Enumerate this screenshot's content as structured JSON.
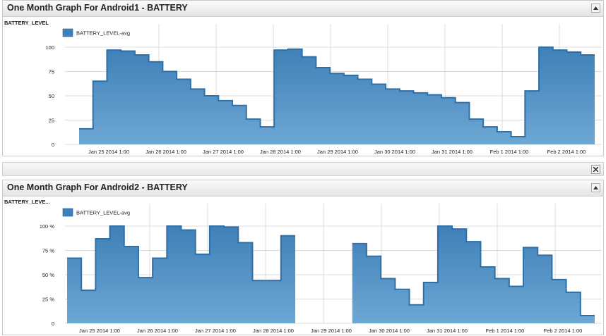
{
  "panels": [
    {
      "title": "One Month Graph For Android1 - BATTERY",
      "ylabel": "BATTERY_LEVEL"
    },
    {
      "title": "One Month Graph For Android2 - BATTERY",
      "ylabel": "BATTERY_LEVE..."
    }
  ],
  "colors": {
    "fill": "#4d8ec4",
    "line": "#2f6fa8",
    "legend": "#3d7fbf"
  },
  "icons": {
    "collapse": "chevron-up-icon",
    "close": "close-icon"
  },
  "chart_data": [
    {
      "type": "area",
      "title": "One Month Graph For Android1 - BATTERY",
      "ylabel": "BATTERY_LEVEL",
      "xlabel": "",
      "ylim": [
        0,
        100
      ],
      "grid": true,
      "legend_position": "top-left",
      "yticks": [
        "0",
        "25",
        "50",
        "75",
        "100"
      ],
      "xticks": [
        "Jan 25 2014 1:00",
        "Jan 26 2014 1:00",
        "Jan 27 2014 1:00",
        "Jan 28 2014 1:00",
        "Jan 29 2014 1:00",
        "Jan 30 2014 1:00",
        "Jan 31 2014 1:00",
        "Feb 1 2014 1:00",
        "Feb 2 2014 1:00"
      ],
      "series": [
        {
          "name": "BATTERY_LEVEL-avg",
          "values": [
            16,
            65,
            97,
            96,
            92,
            85,
            75,
            67,
            57,
            50,
            45,
            40,
            26,
            18,
            97,
            98,
            90,
            79,
            73,
            71,
            67,
            62,
            57,
            55,
            53,
            51,
            48,
            43,
            26,
            18,
            13,
            8,
            55,
            100,
            97,
            95,
            92
          ]
        }
      ]
    },
    {
      "type": "area",
      "title": "One Month Graph For Android2 - BATTERY",
      "ylabel": "BATTERY_LEVE...",
      "xlabel": "",
      "ylim": [
        0,
        100
      ],
      "grid": true,
      "legend_position": "top-left",
      "yticks": [
        "0",
        "25 %",
        "50 %",
        "75 %",
        "100 %"
      ],
      "xticks": [
        "Jan 25 2014 1:00",
        "Jan 26 2014 1:00",
        "Jan 27 2014 1:00",
        "Jan 28 2014 1:00",
        "Jan 29 2014 1:00",
        "Jan 30 2014 1:00",
        "Jan 31 2014 1:00",
        "Feb 1 2014 1:00",
        "Feb 2 2014 1:00"
      ],
      "series": [
        {
          "name": "BATTERY_LEVEL-avg",
          "values": [
            67,
            34,
            87,
            100,
            79,
            47,
            67,
            100,
            96,
            71,
            100,
            99,
            83,
            44,
            44,
            90,
            null,
            null,
            null,
            null,
            82,
            69,
            46,
            35,
            19,
            42,
            100,
            97,
            84,
            58,
            46,
            38,
            78,
            70,
            45,
            32,
            8
          ]
        }
      ]
    }
  ]
}
